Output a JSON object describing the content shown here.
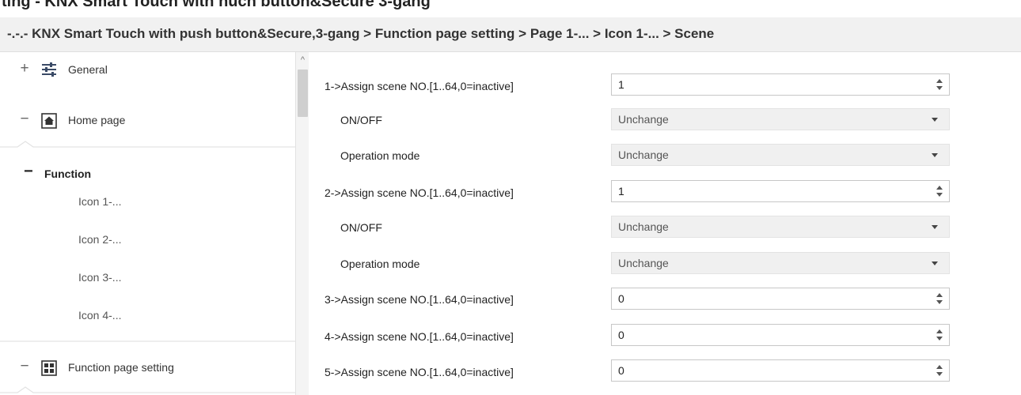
{
  "window": {
    "top_cut_text": "ting - KNX Smart Touch with nuch button&Secure 3-gang"
  },
  "breadcrumb": "-.-.- KNX Smart Touch with push button&Secure,3-gang > Function page setting > Page 1-... > Icon 1-... > Scene",
  "sidebar": {
    "general": {
      "toggle": "+",
      "label": "General",
      "icon": "sliders-icon"
    },
    "home_page": {
      "toggle": "−",
      "label": "Home page",
      "icon": "home-icon"
    },
    "function": {
      "toggle": "−",
      "label": "Function"
    },
    "icons": [
      "Icon 1-...",
      "Icon 2-...",
      "Icon 3-...",
      "Icon 4-..."
    ],
    "function_page_setting": {
      "toggle": "−",
      "label": "Function page setting",
      "icon": "grid-icon"
    }
  },
  "params": {
    "rows": [
      {
        "label": "1->Assign scene NO.[1..64,0=inactive]",
        "value": "1",
        "kind": "spin"
      },
      {
        "label": "ON/OFF",
        "value": "Unchange",
        "kind": "dropdown"
      },
      {
        "label": "Operation mode",
        "value": "Unchange",
        "kind": "dropdown"
      },
      {
        "label": "2->Assign scene NO.[1..64,0=inactive]",
        "value": "1",
        "kind": "spin"
      },
      {
        "label": "ON/OFF",
        "value": "Unchange",
        "kind": "dropdown"
      },
      {
        "label": "Operation mode",
        "value": "Unchange",
        "kind": "dropdown"
      },
      {
        "label": "3->Assign scene NO.[1..64,0=inactive]",
        "value": "0",
        "kind": "spin"
      },
      {
        "label": "4->Assign scene NO.[1..64,0=inactive]",
        "value": "0",
        "kind": "spin"
      },
      {
        "label": "5->Assign scene NO.[1..64,0=inactive]",
        "value": "0",
        "kind": "spin"
      }
    ]
  },
  "colors": {
    "breadcrumb_bg": "#f1f1f1",
    "dropdown_bg": "#f0f0f0",
    "field_border": "#c7c7c7"
  }
}
